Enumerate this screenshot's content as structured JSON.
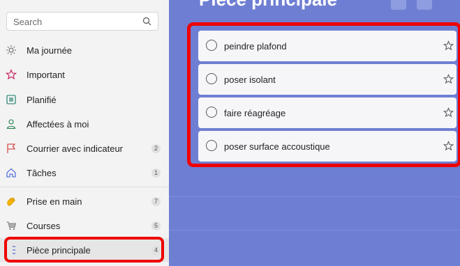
{
  "search": {
    "placeholder": "Search"
  },
  "sidebar": {
    "items": [
      {
        "label": "Ma journée",
        "icon": "sun-icon",
        "count": ""
      },
      {
        "label": "Important",
        "icon": "star-icon",
        "count": ""
      },
      {
        "label": "Planifié",
        "icon": "calendar-grid-icon",
        "count": ""
      },
      {
        "label": "Affectées à moi",
        "icon": "person-icon",
        "count": ""
      },
      {
        "label": "Courrier avec indicateur",
        "icon": "flag-icon",
        "count": "2"
      },
      {
        "label": "Tâches",
        "icon": "home-icon",
        "count": "1"
      },
      {
        "label": "Prise en main",
        "icon": "waving-hand-icon",
        "count": "7"
      },
      {
        "label": "Courses",
        "icon": "cart-icon",
        "count": "5"
      },
      {
        "label": "Pièce principale",
        "icon": "list-icon",
        "count": "4"
      }
    ]
  },
  "main": {
    "title": "Pièce principale",
    "tasks": [
      {
        "label": "peindre plafond"
      },
      {
        "label": "poser isolant"
      },
      {
        "label": "faire réagréage"
      },
      {
        "label": "poser surface accoustique"
      }
    ]
  },
  "colors": {
    "main_background": "#6e7fd3",
    "highlight_red": "#ee0000",
    "sidebar_background": "#f3f3f3"
  }
}
